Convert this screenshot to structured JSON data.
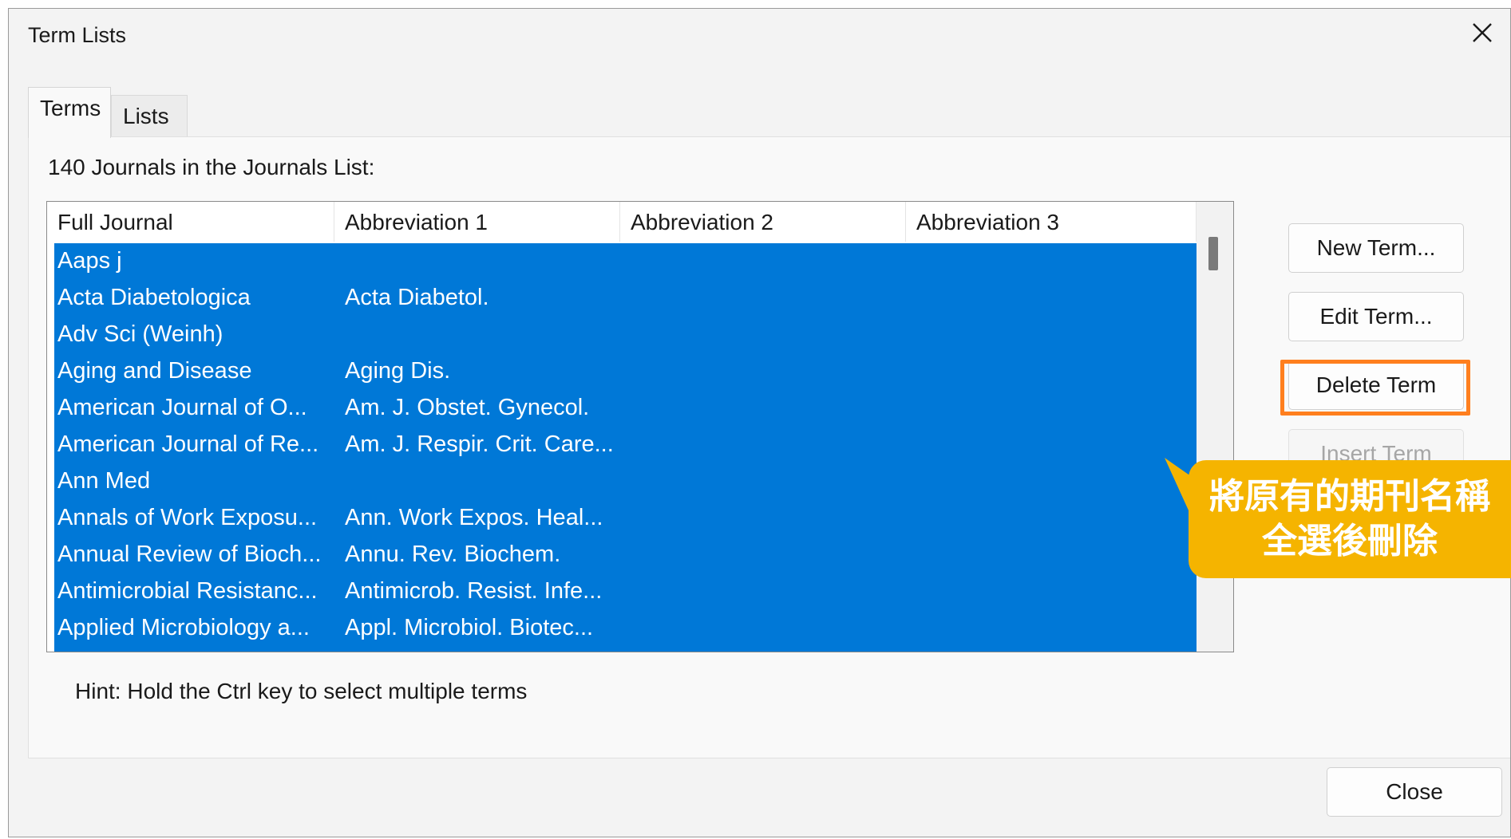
{
  "window": {
    "title": "Term Lists",
    "close_icon": "close-icon"
  },
  "tabs": [
    {
      "label": "Terms",
      "active": true
    },
    {
      "label": "Lists",
      "active": false
    }
  ],
  "list": {
    "count_label": "140 Journals in the Journals List:",
    "columns": [
      "Full Journal",
      "Abbreviation 1",
      "Abbreviation 2",
      "Abbreviation 3"
    ],
    "rows": [
      [
        "Aaps j",
        "",
        "",
        ""
      ],
      [
        "Acta Diabetologica",
        "Acta Diabetol.",
        "",
        ""
      ],
      [
        "Adv Sci (Weinh)",
        "",
        "",
        ""
      ],
      [
        "Aging and Disease",
        "Aging Dis.",
        "",
        ""
      ],
      [
        "American Journal of O...",
        "Am. J. Obstet. Gynecol.",
        "",
        ""
      ],
      [
        "American Journal of Re...",
        "Am. J. Respir. Crit. Care...",
        "",
        ""
      ],
      [
        "Ann Med",
        "",
        "",
        ""
      ],
      [
        "Annals of Work Exposu...",
        "Ann. Work Expos. Heal...",
        "",
        ""
      ],
      [
        "Annual Review of Bioch...",
        "Annu. Rev. Biochem.",
        "",
        ""
      ],
      [
        "Antimicrobial Resistanc...",
        "Antimicrob. Resist. Infe...",
        "",
        ""
      ],
      [
        "Applied Microbiology a...",
        "Appl. Microbiol. Biotec...",
        "",
        ""
      ]
    ],
    "selection_color": "#0078d7"
  },
  "buttons": {
    "new_term": "New Term...",
    "edit_term": "Edit Term...",
    "delete_term": "Delete Term",
    "insert_term": "Insert Term",
    "close": "Close"
  },
  "hint": "Hint: Hold the Ctrl key to select multiple terms",
  "annotation": {
    "line1": "將原有的期刊名稱",
    "line2": "全選後刪除",
    "color": "#f5b400",
    "highlight_color": "#ff7f1e"
  }
}
